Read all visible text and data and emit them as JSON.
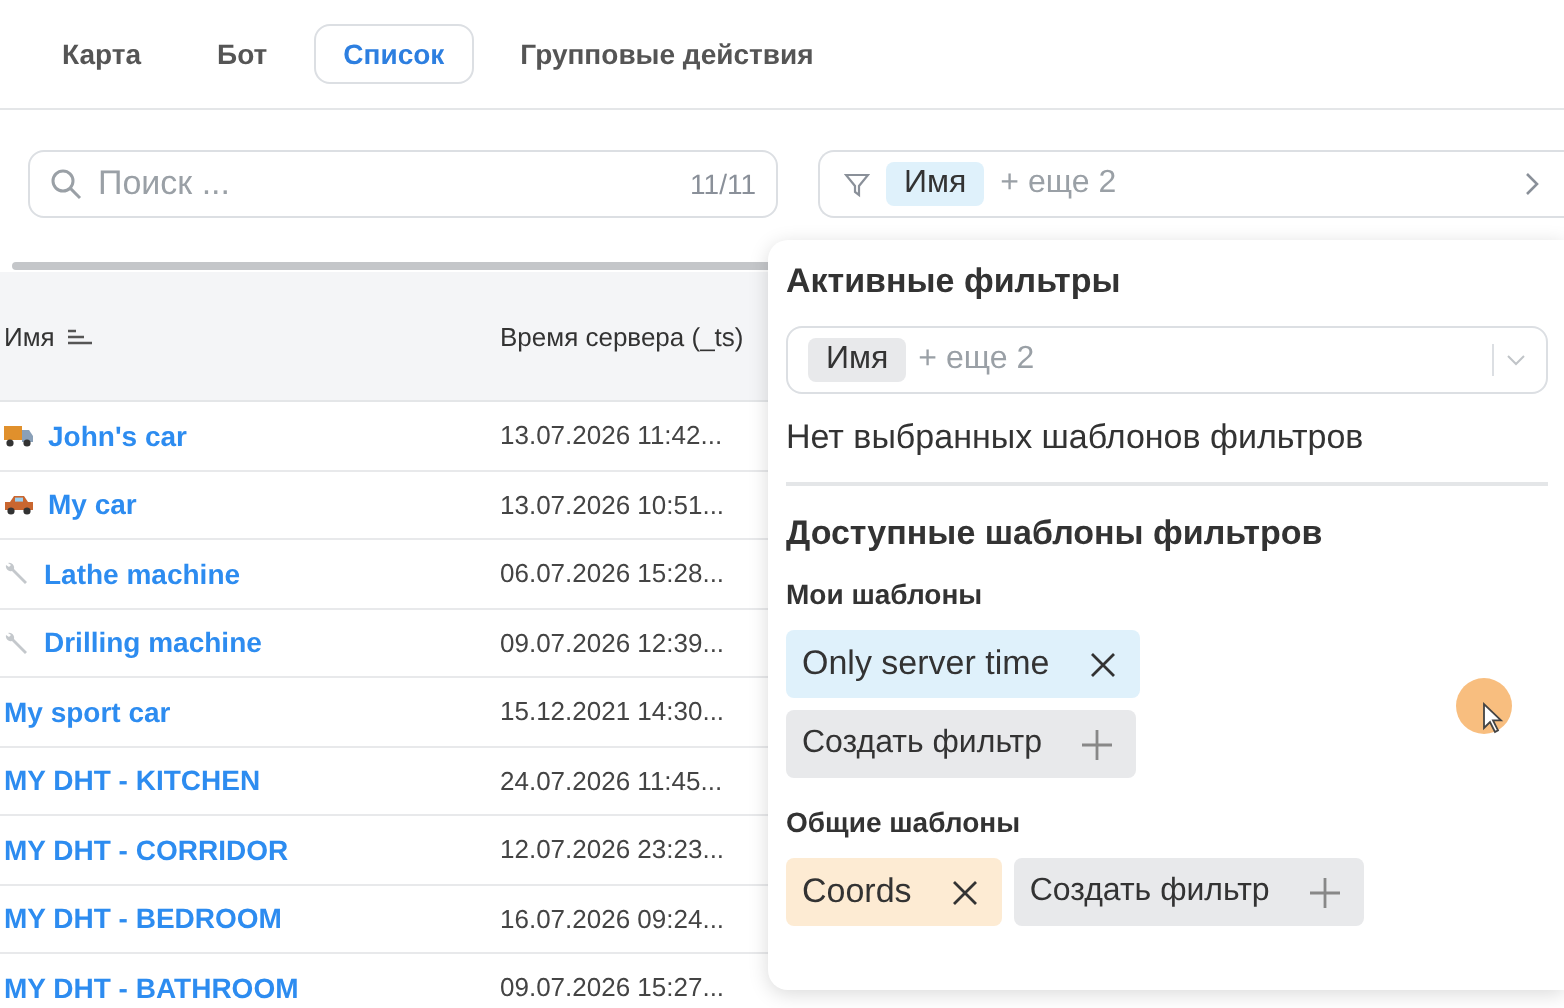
{
  "tabs": [
    {
      "label": "Карта",
      "selected": false
    },
    {
      "label": "Бот",
      "selected": false
    },
    {
      "label": "Список",
      "selected": true
    },
    {
      "label": "Групповые действия",
      "selected": false
    }
  ],
  "search": {
    "placeholder": "Поиск ...",
    "count": "11/11"
  },
  "filter_bar": {
    "chip": "Имя",
    "more": "+ еще 2"
  },
  "table": {
    "columns": [
      "Имя",
      "Время сервера (_ts)"
    ],
    "rows": [
      {
        "kind": "truck",
        "name": "John's car",
        "time": "13.07.2026 11:42..."
      },
      {
        "kind": "car",
        "name": "My car",
        "time": "13.07.2026 10:51..."
      },
      {
        "kind": "wrench",
        "name": "Lathe machine",
        "time": "06.07.2026 15:28..."
      },
      {
        "kind": "wrench",
        "name": "Drilling machine",
        "time": "09.07.2026 12:39..."
      },
      {
        "kind": "plain",
        "name": "My sport car",
        "time": "15.12.2021 14:30..."
      },
      {
        "kind": "plain",
        "name": "MY DHT - KITCHEN",
        "time": "24.07.2026 11:45..."
      },
      {
        "kind": "plain",
        "name": "MY DHT - CORRIDOR",
        "time": "12.07.2026 23:23..."
      },
      {
        "kind": "plain",
        "name": "MY DHT - BEDROOM",
        "time": "16.07.2026 09:24..."
      },
      {
        "kind": "plain",
        "name": "MY DHT - BATHROOM",
        "time": "09.07.2026 15:27..."
      }
    ]
  },
  "filter_popup": {
    "title": "Активные фильтры",
    "chip": "Имя",
    "more": "+ еще 2",
    "empty_text": "Нет выбранных шаблонов фильтров",
    "templates_title": "Доступные шаблоны фильтров",
    "groups": [
      {
        "title": "Мои шаблоны",
        "templates": [
          {
            "label": "Only server time",
            "color": "#dff1fb"
          }
        ],
        "create": "Создать фильтр"
      },
      {
        "title": "Общие шаблоны",
        "templates": [
          {
            "label": "Coords",
            "color": "#fdebd3"
          }
        ],
        "create": "Создать фильтр"
      }
    ]
  }
}
